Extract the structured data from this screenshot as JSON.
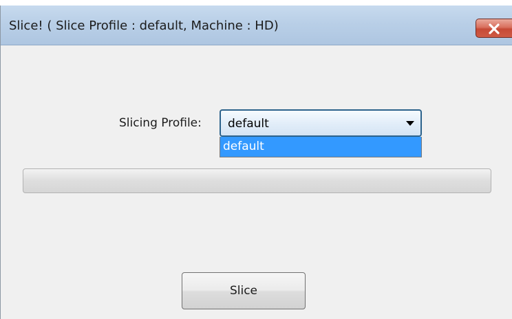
{
  "window": {
    "title": "Slice!   ( Slice Profile : default, Machine : HD)"
  },
  "icons": {
    "close": "close-x-icon",
    "dropdown_arrow": "triangle-down-icon"
  },
  "colors": {
    "titlebar": "#b9cfe7",
    "close_button": "#c64a36",
    "selection": "#3399ff",
    "dialog_background": "#f0f0f0"
  },
  "form": {
    "profile_label": "Slicing Profile:",
    "profile_selected": "default",
    "profile_options": [
      "default"
    ]
  },
  "progress": {
    "value_percent": 0
  },
  "actions": {
    "slice_label": "Slice"
  }
}
